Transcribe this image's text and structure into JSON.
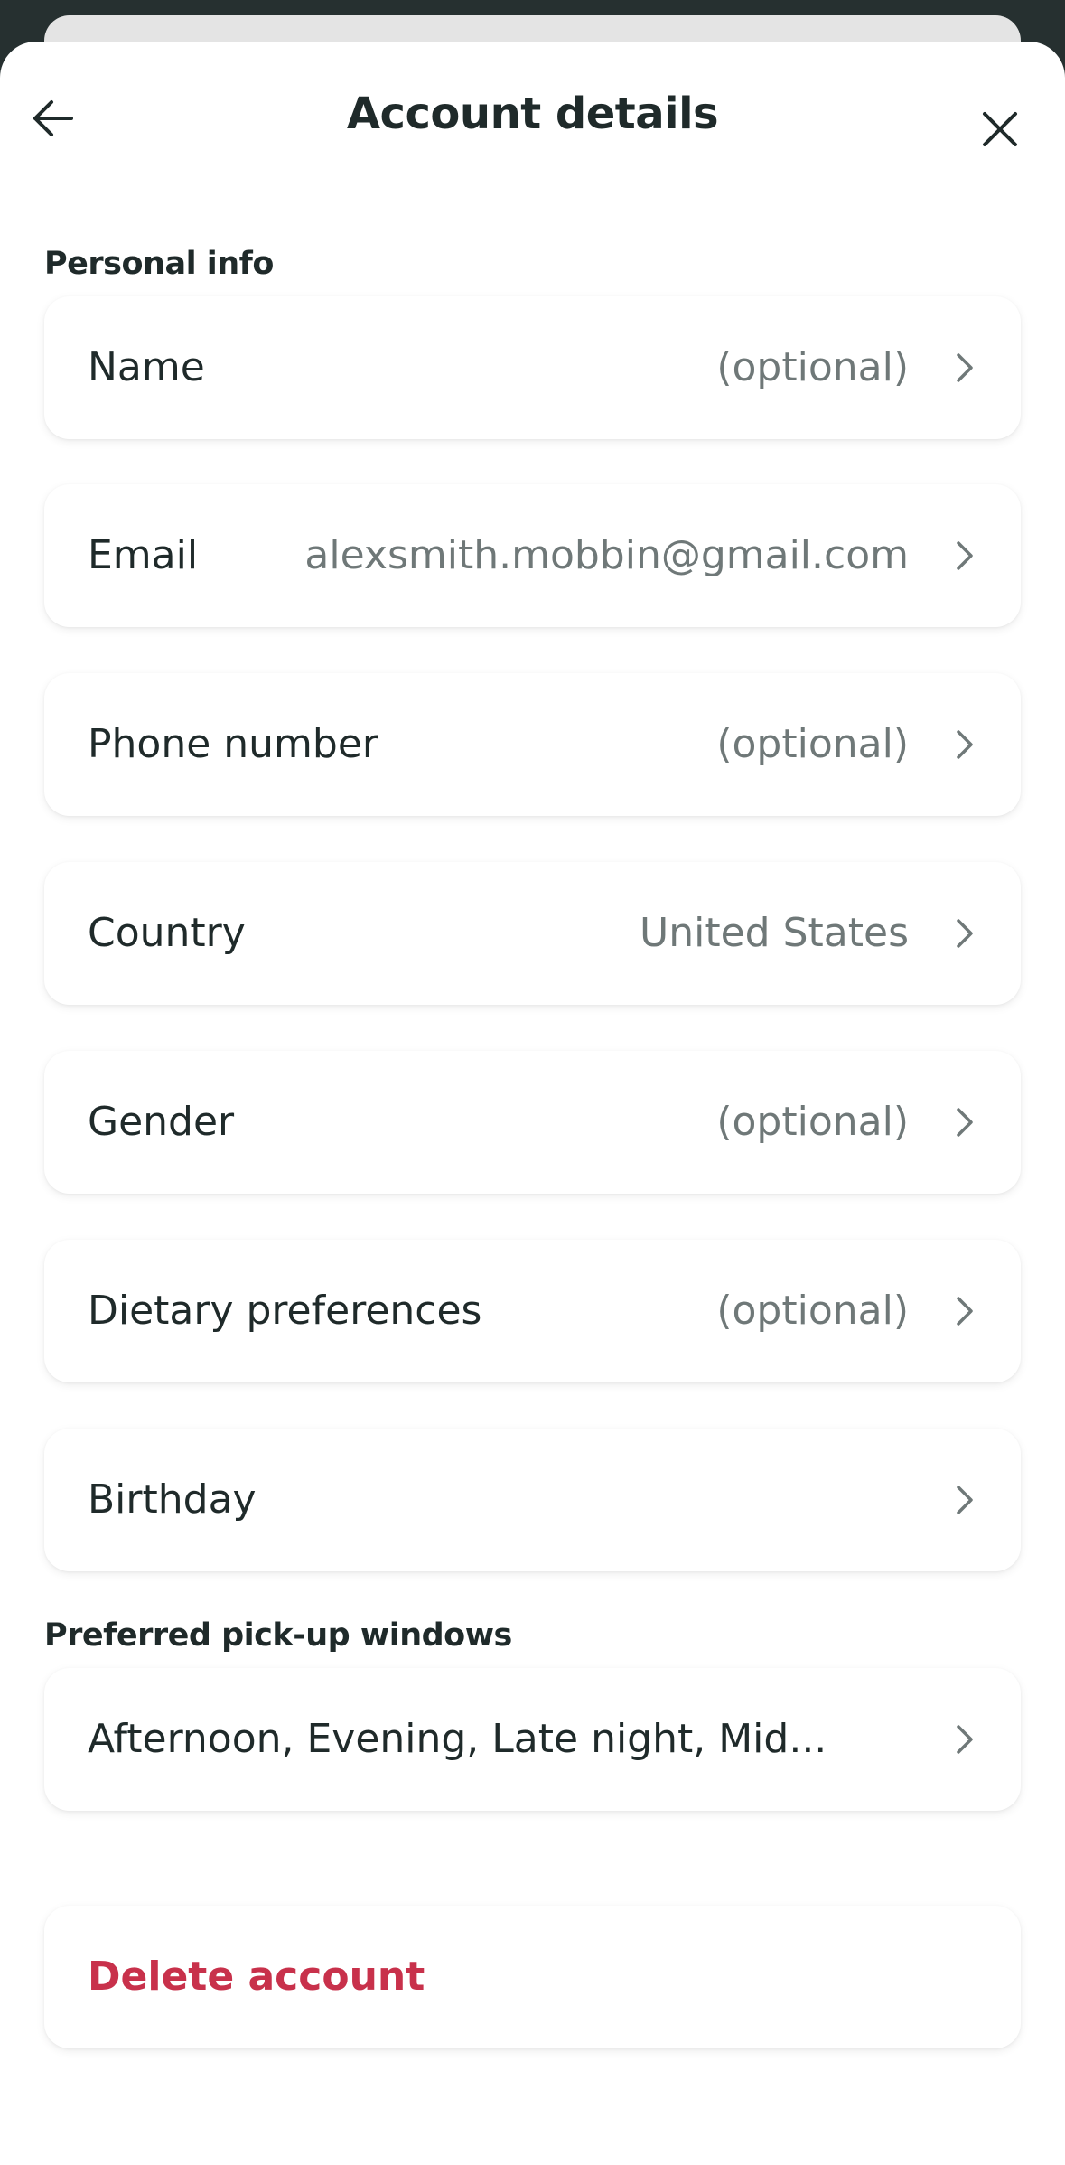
{
  "header": {
    "title": "Account details",
    "back_icon": "arrow-left-icon",
    "close_icon": "close-icon"
  },
  "personal_info": {
    "section_label": "Personal info",
    "rows": [
      {
        "label": "Name",
        "value": "(optional)"
      },
      {
        "label": "Email",
        "value": "alexsmith.mobbin@gmail.com"
      },
      {
        "label": "Phone number",
        "value": "(optional)"
      },
      {
        "label": "Country",
        "value": "United States"
      },
      {
        "label": "Gender",
        "value": "(optional)"
      },
      {
        "label": "Dietary preferences",
        "value": "(optional)"
      },
      {
        "label": "Birthday",
        "value": ""
      }
    ]
  },
  "pickup": {
    "section_label": "Preferred pick-up windows",
    "value": "Afternoon, Evening, Late night, Mid..."
  },
  "delete": {
    "label": "Delete account"
  },
  "colors": {
    "text": "#1f2a2a",
    "muted": "#6f7878",
    "danger": "#c8314b",
    "background_dark": "#263030"
  }
}
